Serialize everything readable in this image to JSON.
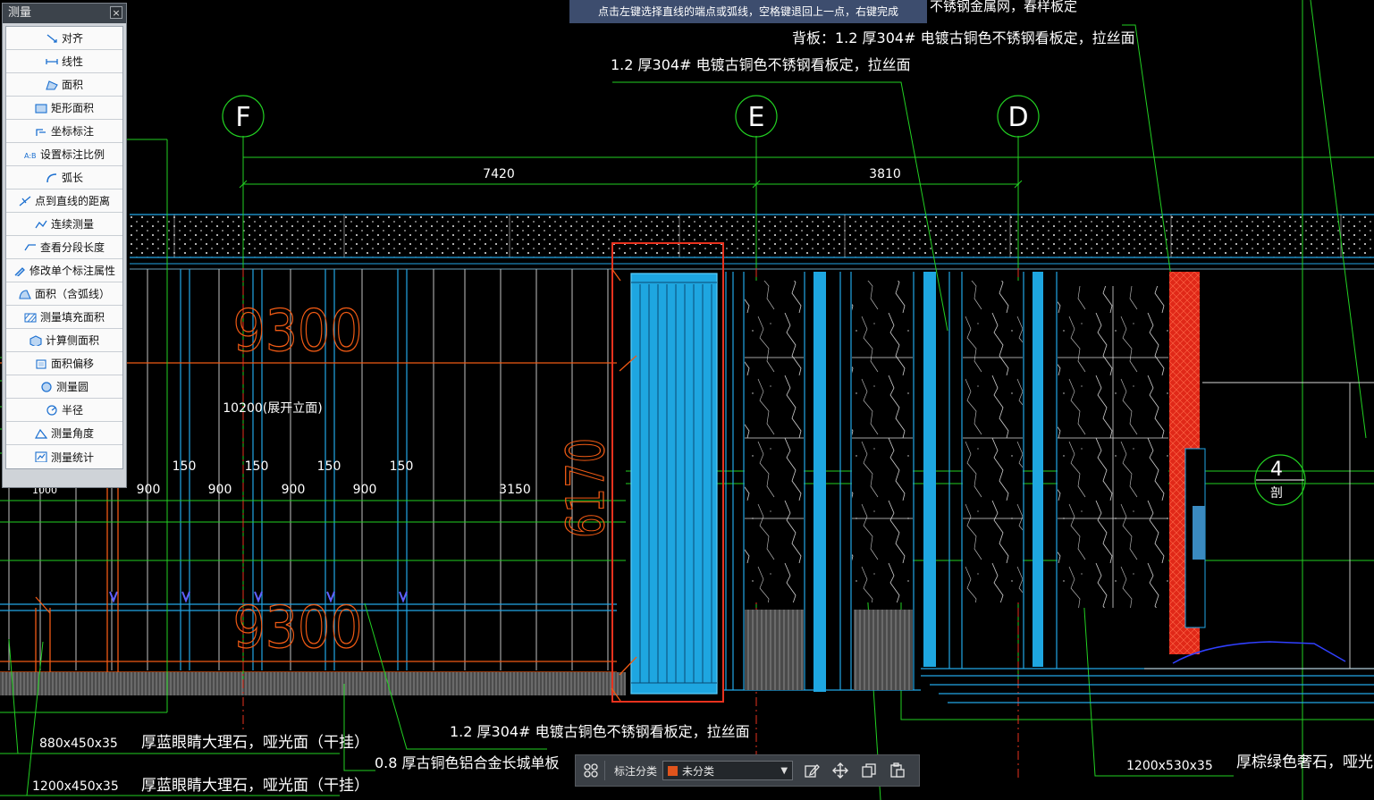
{
  "panel": {
    "title": "测量",
    "close": "×",
    "items": [
      {
        "label": "对齐",
        "icon": "align-measure-icon"
      },
      {
        "label": "线性",
        "icon": "linear-measure-icon"
      },
      {
        "label": "面积",
        "icon": "area-icon"
      },
      {
        "label": "矩形面积",
        "icon": "rect-area-icon"
      },
      {
        "label": "坐标标注",
        "icon": "coordinate-icon"
      },
      {
        "label": "设置标注比例",
        "icon": "scale-icon"
      },
      {
        "label": "弧长",
        "icon": "arc-length-icon"
      },
      {
        "label": "点到直线的距离",
        "icon": "point-line-distance-icon"
      },
      {
        "label": "连续测量",
        "icon": "continuous-measure-icon"
      },
      {
        "label": "查看分段长度",
        "icon": "segment-length-icon"
      },
      {
        "label": "修改单个标注属性",
        "icon": "edit-dimension-icon"
      },
      {
        "label": "面积（含弧线）",
        "icon": "arc-area-icon"
      },
      {
        "label": "测量填充面积",
        "icon": "hatch-area-icon"
      },
      {
        "label": "计算侧面积",
        "icon": "side-area-icon"
      },
      {
        "label": "面积偏移",
        "icon": "area-offset-icon"
      },
      {
        "label": "测量圆",
        "icon": "circle-measure-icon"
      },
      {
        "label": "半径",
        "icon": "radius-icon"
      },
      {
        "label": "测量角度",
        "icon": "angle-icon"
      },
      {
        "label": "测量统计",
        "icon": "statistics-icon"
      }
    ]
  },
  "tooltip": "点击左键选择直线的端点或弧线，空格键退回上一点，右键完成",
  "toolbar": {
    "label": "标注分类",
    "selected": "未分类",
    "swatch_color": "#e0541c",
    "icons": [
      "grid-icon",
      "edit-icon",
      "move-icon",
      "copy-icon",
      "paste-icon"
    ]
  },
  "drawing": {
    "axis_labels": {
      "f": "F",
      "e": "E",
      "d": "D",
      "four": "4",
      "four_sub": "剖"
    },
    "dims": {
      "d7420": "7420",
      "d3810": "3810",
      "d10200": "10200(展开立面)",
      "d150": "150",
      "d900": "900",
      "d3150": "3150",
      "d1000": "1000",
      "big9300": "9300",
      "big6170": "6170"
    },
    "notes": {
      "top_partial": "不锈钢金属网，春样板定",
      "back_board": "背板：1.2  厚304#  电镀古铜色不锈钢看板定，拉丝面",
      "mid_note": "1.2  厚304#  电镀古铜色不锈钢看板定，拉丝面",
      "bottom_steel": "1.2  厚304#  电镀古铜色不锈钢看板定，拉丝面",
      "aluminum": "0.8  厚古铜色铝合金长城单板",
      "size1": "880x450x35",
      "marble1": "厚蓝眼睛大理石，哑光面（干挂）",
      "size2": "1200x450x35",
      "marble2": "厚蓝眼睛大理石，哑光面（干挂）",
      "size3": "1200x530x35",
      "green_stone": "厚棕绿色奢石，哑光面（"
    },
    "colors": {
      "cyan": "#22a6e6",
      "red": "#e8321e",
      "green": "#22d022",
      "orange": "#f05a14"
    }
  }
}
